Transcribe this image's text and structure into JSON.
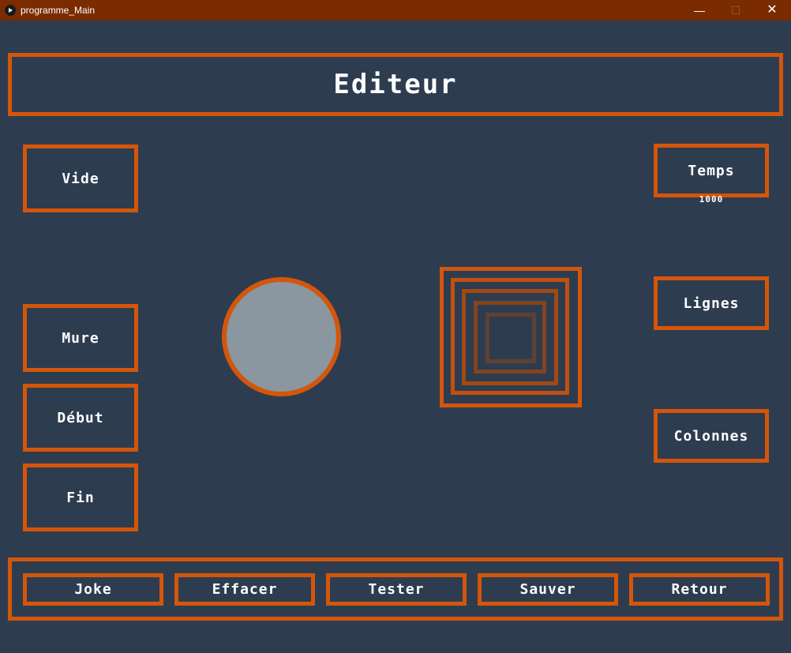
{
  "window": {
    "title": "programme_Main",
    "minimize": "—",
    "maximize": "☐",
    "close": "✕"
  },
  "header": {
    "title": "Editeur"
  },
  "left_buttons": {
    "vide": "Vide",
    "mure": "Mure",
    "debut": "Début",
    "fin": "Fin"
  },
  "right_buttons": {
    "temps": "Temps",
    "temps_value": "1000",
    "lignes": "Lignes",
    "colonnes": "Colonnes"
  },
  "bottom_buttons": {
    "joke": "Joke",
    "effacer": "Effacer",
    "tester": "Tester",
    "sauver": "Sauver",
    "retour": "Retour"
  },
  "colors": {
    "background": "#2e3c50",
    "accent": "#d4560a",
    "titlebar": "#7a2c00",
    "ball": "#8a96a0"
  }
}
